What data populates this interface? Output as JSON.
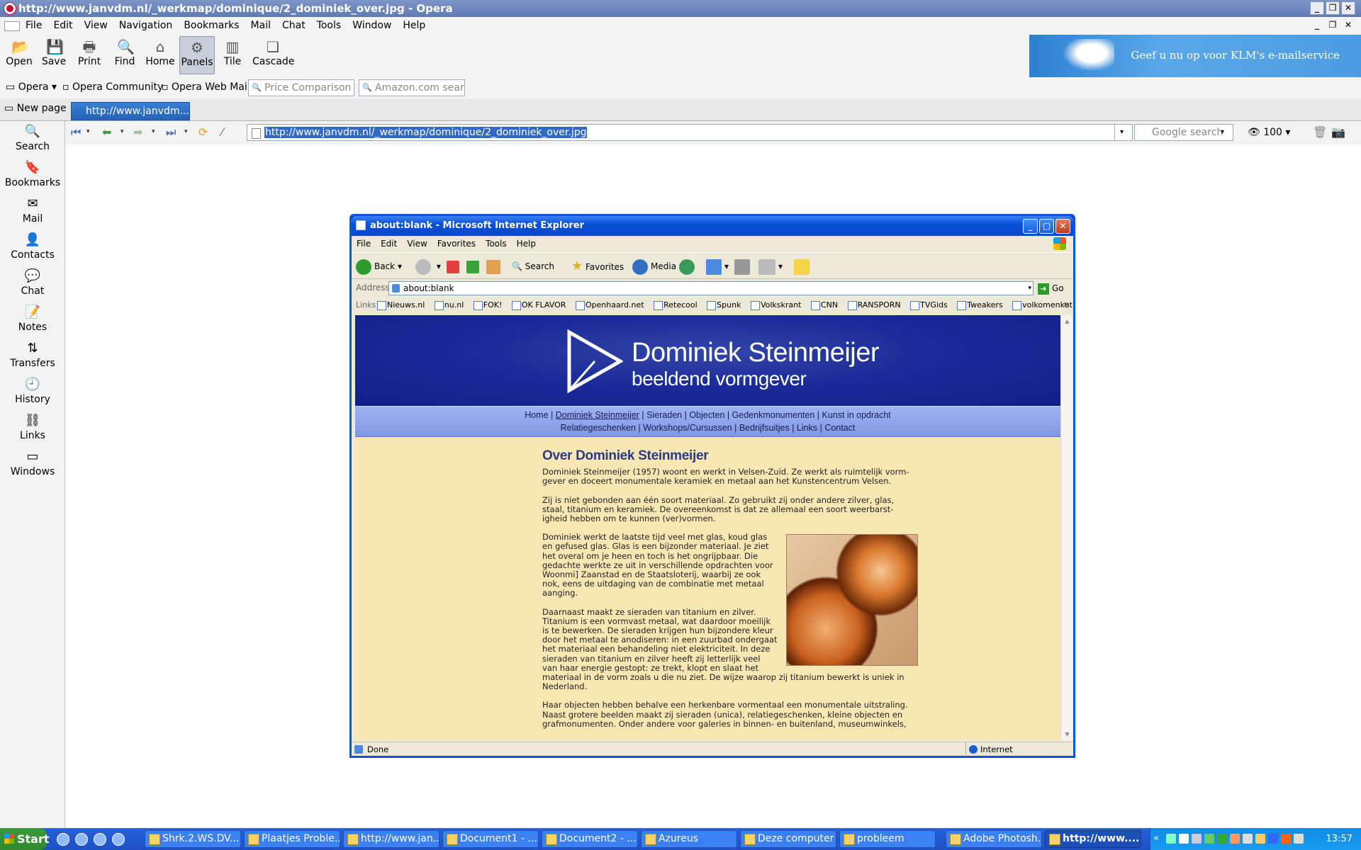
{
  "opera": {
    "title": "http://www.janvdm.nl/_werkmap/dominique/2_dominiek_over.jpg - Opera",
    "menu": [
      "File",
      "Edit",
      "View",
      "Navigation",
      "Bookmarks",
      "Mail",
      "Chat",
      "Tools",
      "Window",
      "Help"
    ],
    "toolbar": [
      {
        "label": "Open",
        "icon": "open-folder-icon"
      },
      {
        "label": "Save",
        "icon": "save-icon"
      },
      {
        "label": "Print",
        "icon": "print-icon"
      },
      {
        "label": "Find",
        "icon": "find-icon"
      },
      {
        "label": "Home",
        "icon": "home-icon"
      },
      {
        "label": "Panels",
        "icon": "panels-icon",
        "active": true
      },
      {
        "label": "Tile",
        "icon": "tile-icon"
      },
      {
        "label": "Cascade",
        "icon": "cascade-icon"
      }
    ],
    "banner_text": "Geef u nu op voor KLM's e-mailservice",
    "personal_bar": {
      "opera": "Opera",
      "community": "Opera Community",
      "webmail": "Opera Web Mail",
      "price_search_placeholder": "Price Comparison se",
      "amazon_search_placeholder": "Amazon.com search"
    },
    "tabs": {
      "new_page": "New page",
      "active_tab": "http://www.janvdm...."
    },
    "panel": [
      "Search",
      "Bookmarks",
      "Mail",
      "Contacts",
      "Chat",
      "Notes",
      "Transfers",
      "History",
      "Links",
      "Windows"
    ],
    "address": "http://www.janvdm.nl/_werkmap/dominique/2_dominiek_over.jpg",
    "google_search_placeholder": "Google search",
    "zoom": "100"
  },
  "ie": {
    "title": "about:blank - Microsoft Internet Explorer",
    "menu": [
      "File",
      "Edit",
      "View",
      "Favorites",
      "Tools",
      "Help"
    ],
    "buttons": {
      "back": "Back",
      "search": "Search",
      "favorites": "Favorites",
      "media": "Media"
    },
    "address_label": "Address",
    "address": "about:blank",
    "go": "Go",
    "links_label": "Links",
    "links": [
      "Nieuws.nl",
      "nu.nl",
      "FOK!",
      "OK FLAVOR",
      "Openhaard.net",
      "Retecool",
      "Spunk",
      "Volkskrant",
      "CNN",
      "RANSPORN",
      "TVGids",
      "Tweakers",
      "volkomenkut"
    ],
    "status": "Done",
    "zone": "Internet"
  },
  "site": {
    "name": "Dominiek Steinmeijer",
    "tagline": "beeldend vormgever",
    "nav_row1": [
      "Home",
      "Dominiek Steinmeijer",
      "Sieraden",
      "Objecten",
      "Gedenkmonumenten",
      "Kunst in opdracht"
    ],
    "nav_row2": [
      "Relatiegeschenken",
      "Workshops/Cursussen",
      "Bedrijfsuitjes",
      "Links",
      "Contact"
    ],
    "heading": "Over Dominiek Steinmeijer",
    "p1": "Dominiek Steinmeijer (1957) woont en werkt in Velsen-Zuid. Ze werkt als ruimtelijk vorm-gever en doceert monumentale keramiek en metaal aan het Kunstencentrum Velsen.",
    "p2": "Zij is niet gebonden aan één soort materiaal. Zo gebruikt zij onder andere zilver, glas, staal, titanium en keramiek. De overeenkomst is dat ze allemaal een soort weerbarst-igheid hebben om te kunnen (ver)vormen.",
    "p3": "Dominiek werkt de laatste tijd veel met glas, koud glas en gefused glas. Glas is een bijzonder materiaal. Je ziet het overal om je heen en toch is het ongrijpbaar. Die gedachte werkte ze uit in verschillende opdrachten voor Woonmi] Zaanstad en de Staatsloterij, waarbij ze ook nok, eens de uitdaging van de combinatie met metaal aanging.",
    "p4": "Daarnaast maakt ze sieraden van titanium en zilver. Titanium is een vormvast metaal, wat daardoor moeilijk is te bewerken. De sieraden krijgen hun bijzondere kleur door het metaal te anodiseren: in een zuurbad ondergaat het materiaal een behandeling niet elektriciteit. In deze sieraden van titanium en zilver heeft zij letterlijk veel van haar energie gestopt: ze trekt, klopt en slaat het materiaal in de vorm zoals u die nu ziet. De wijze waarop zij titanium bewerkt is uniek in Nederland.",
    "p5": "Haar objecten hebben behalve een herkenbare vormentaal een monumentale uitstraling. Naast grotere beelden maakt zij sieraden (unica), relatiegeschenken, kleine objecten en grafmonumenten. Onder andere voor galeries in binnen- en buitenland, museumwinkels,"
  },
  "taskbar": {
    "start": "Start",
    "tasks": [
      "Shrk.2.WS.DV...",
      "Plaatjes Proble...",
      "http://www.jan...",
      "Document1 - ...",
      "Document2 - ...",
      "Azureus",
      "Deze computer",
      "probleem",
      "Adobe Photosh...",
      "http://www...."
    ],
    "clock": "13:57"
  }
}
